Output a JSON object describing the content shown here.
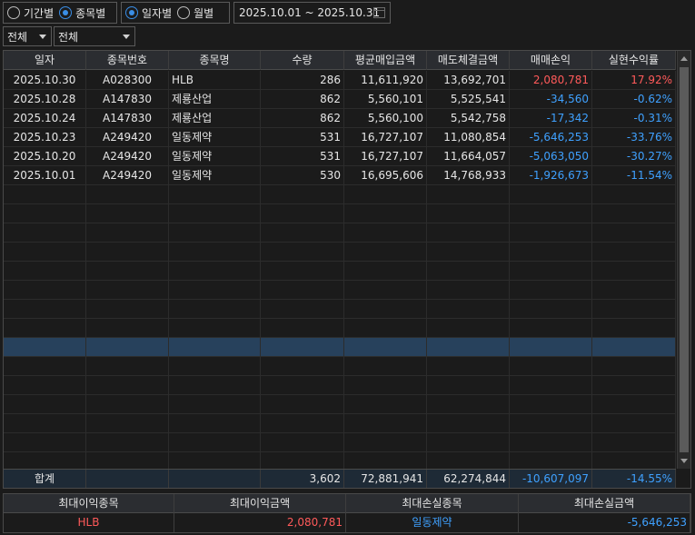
{
  "filters": {
    "group1": [
      {
        "label": "기간별",
        "selected": false
      },
      {
        "label": "종목별",
        "selected": true
      }
    ],
    "group2": [
      {
        "label": "일자별",
        "selected": true
      },
      {
        "label": "월별",
        "selected": false
      }
    ],
    "date_range": "2025.10.01 ~ 2025.10.31",
    "select1": "전체",
    "select2": "전체"
  },
  "table": {
    "headers": [
      "일자",
      "종목번호",
      "종목명",
      "수량",
      "평균매입금액",
      "매도체결금액",
      "매매손익",
      "실현수익률"
    ],
    "rows": [
      [
        "2025.10.30",
        "A028300",
        "HLB",
        "286",
        "11,611,920",
        "13,692,701",
        "2,080,781",
        "17.92%"
      ],
      [
        "2025.10.28",
        "A147830",
        "제룡산업",
        "862",
        "5,560,101",
        "5,525,541",
        "-34,560",
        "-0.62%"
      ],
      [
        "2025.10.24",
        "A147830",
        "제룡산업",
        "862",
        "5,560,100",
        "5,542,758",
        "-17,342",
        "-0.31%"
      ],
      [
        "2025.10.23",
        "A249420",
        "일동제약",
        "531",
        "16,727,107",
        "11,080,854",
        "-5,646,253",
        "-33.76%"
      ],
      [
        "2025.10.20",
        "A249420",
        "일동제약",
        "531",
        "16,727,107",
        "11,664,057",
        "-5,063,050",
        "-30.27%"
      ],
      [
        "2025.10.01",
        "A249420",
        "일동제약",
        "530",
        "16,695,606",
        "14,768,933",
        "-1,926,673",
        "-11.54%"
      ]
    ],
    "total": {
      "label": "합계",
      "qty": "3,602",
      "avg_buy": "72,881,941",
      "sell": "62,274,844",
      "pnl": "-10,607,097",
      "rate": "-14.55%"
    }
  },
  "summary": {
    "headers": [
      "최대이익종목",
      "최대이익금액",
      "최대손실종목",
      "최대손실금액"
    ],
    "values": [
      "HLB",
      "2,080,781",
      "일동제약",
      "-5,646,253"
    ]
  },
  "colors": {
    "profit": "#ff5a5a",
    "loss": "#3fa1ff",
    "selected_row": "#27415c",
    "radio_accent": "#3a8ee6"
  }
}
